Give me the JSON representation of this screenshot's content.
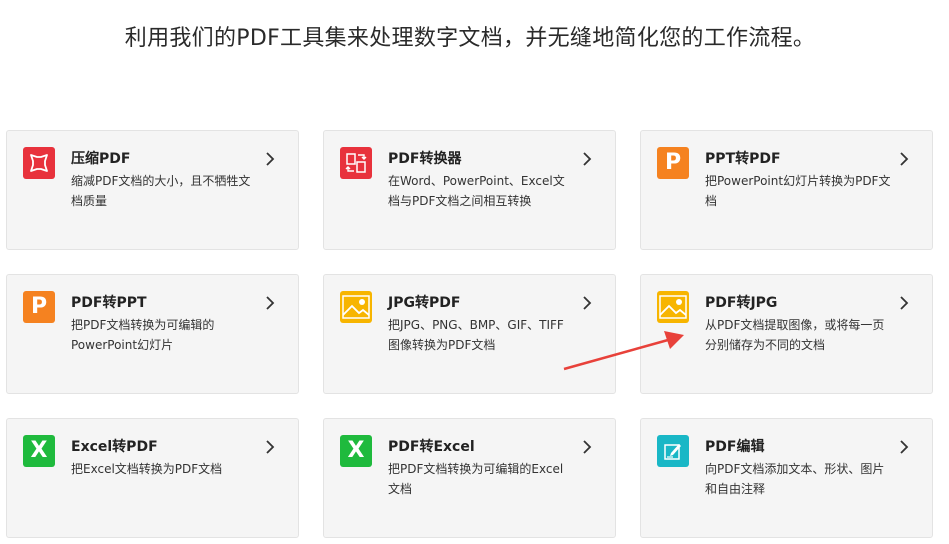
{
  "headline": "利用我们的PDF工具集来处理数字文档，并无缝地简化您的工作流程。",
  "cards": [
    {
      "title": "压缩PDF",
      "desc": "缩减PDF文档的大小，且不牺牲文档质量",
      "icon": "compress-icon",
      "color": "#e8323c"
    },
    {
      "title": "PDF转换器",
      "desc": "在Word、PowerPoint、Excel文档与PDF文档之间相互转换",
      "icon": "convert-icon",
      "color": "#e8323c"
    },
    {
      "title": "PPT转PDF",
      "desc": "把PowerPoint幻灯片转换为PDF文档",
      "icon": "powerpoint-icon",
      "color": "#f58220"
    },
    {
      "title": "PDF转PPT",
      "desc": "把PDF文档转换为可编辑的PowerPoint幻灯片",
      "icon": "powerpoint-icon",
      "color": "#f58220"
    },
    {
      "title": "JPG转PDF",
      "desc": "把JPG、PNG、BMP、GIF、TIFF图像转换为PDF文档",
      "icon": "image-icon",
      "color": "#f7b500"
    },
    {
      "title": "PDF转JPG",
      "desc": "从PDF文档提取图像，或将每一页分别储存为不同的文档",
      "icon": "image-icon",
      "color": "#f7b500"
    },
    {
      "title": "Excel转PDF",
      "desc": "把Excel文档转换为PDF文档",
      "icon": "excel-icon",
      "color": "#1fba3d"
    },
    {
      "title": "PDF转Excel",
      "desc": "把PDF文档转换为可编辑的Excel文档",
      "icon": "excel-icon",
      "color": "#1fba3d"
    },
    {
      "title": "PDF编辑",
      "desc": "向PDF文档添加文本、形状、图片和自由注释",
      "icon": "edit-icon",
      "color": "#19b7c6"
    }
  ],
  "icon_letters": {
    "powerpoint": "P",
    "excel": "X"
  },
  "annotation_color": "#e8413a"
}
